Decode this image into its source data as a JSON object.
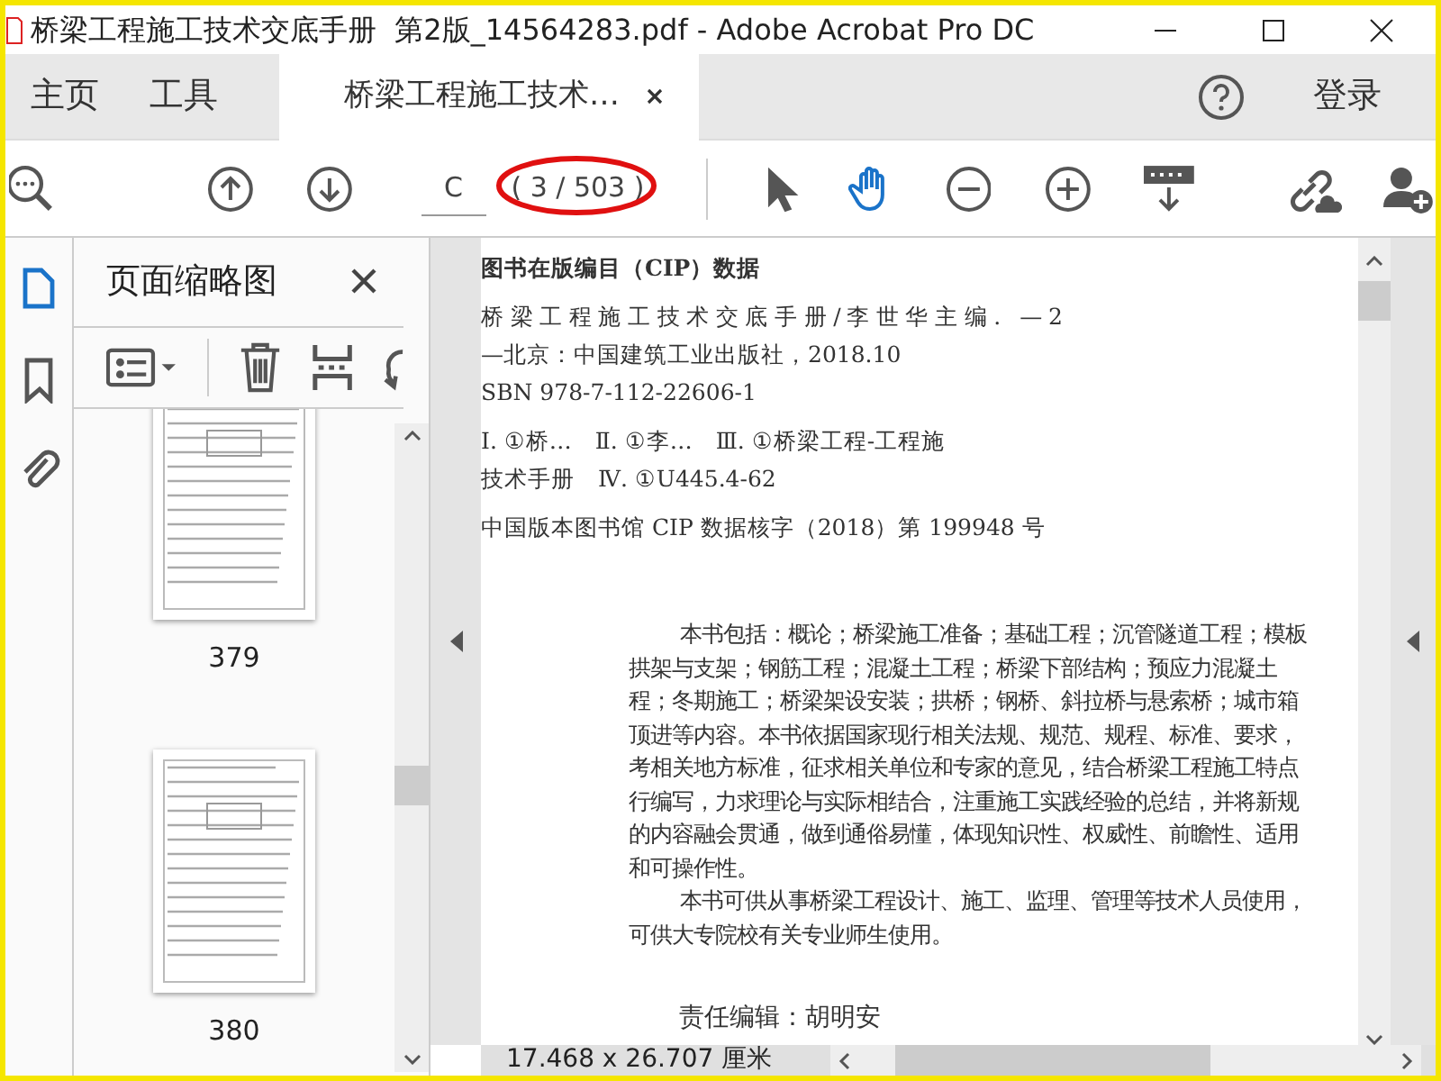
{
  "window": {
    "title": "桥梁工程施工技术交底手册  第2版_14564283.pdf - Adobe Acrobat Pro DC"
  },
  "tabs": [
    {
      "label": "主页",
      "selected": false
    },
    {
      "label": "工具",
      "selected": false
    },
    {
      "label": "桥梁工程施工技术…",
      "selected": true
    }
  ],
  "sign_in": "登录",
  "toolbar": {
    "page_field": {
      "value": "C"
    },
    "page_count": "( 3 / 503 )",
    "page_count_circled": true,
    "tools": [
      {
        "kind": "pointer",
        "selected": false
      },
      {
        "kind": "hand",
        "selected": true
      }
    ]
  },
  "sidebar": {
    "rail": [
      {
        "kind": "pages",
        "selected": true
      },
      {
        "kind": "bookmarks",
        "selected": false
      },
      {
        "kind": "attachments",
        "selected": false
      }
    ],
    "panel": {
      "title": "页面缩略图",
      "thumbnails": [
        {
          "label": "379"
        },
        {
          "label": "380"
        }
      ]
    }
  },
  "document": {
    "lines": [
      {
        "kind": "heading",
        "text": "图书在版编目（CIP）数据"
      },
      {
        "kind": "spaced",
        "text": "桥梁工程施工技术交底手册/李世华主编. —2"
      },
      {
        "kind": "line",
        "text": "—北京：中国建筑工业出版社，2018.10"
      },
      {
        "kind": "line",
        "text": "SBN 978-7-112-22606-1"
      },
      {
        "kind": "line",
        "text": "Ⅰ. ①桥…　Ⅱ. ①李…　Ⅲ. ①桥梁工程-工程施"
      },
      {
        "kind": "line",
        "text": "技术手册　Ⅳ. ①U445.4-62"
      },
      {
        "kind": "line",
        "text": "中国版本图书馆 CIP 数据核字（2018）第 199948 号"
      },
      {
        "kind": "first",
        "text": "本书包括：概论；桥梁施工准备；基础工程；沉管隧道工程；模板"
      },
      {
        "kind": "body",
        "text": "拱架与支架；钢筋工程；混凝土工程；桥梁下部结构；预应力混凝土"
      },
      {
        "kind": "body",
        "text": "程；冬期施工；桥梁架设安装；拱桥；钢桥、斜拉桥与悬索桥；城市箱"
      },
      {
        "kind": "body",
        "text": "顶进等内容。本书依据国家现行相关法规、规范、规程、标准、要求，"
      },
      {
        "kind": "body",
        "text": "考相关地方标准，征求相关单位和专家的意见，结合桥梁工程施工特点"
      },
      {
        "kind": "body",
        "text": "行编写，力求理论与实际相结合，注重施工实践经验的总结，并将新规"
      },
      {
        "kind": "body",
        "text": "的内容融会贯通，做到通俗易懂，体现知识性、权威性、前瞻性、适用"
      },
      {
        "kind": "body",
        "text": "和可操作性。"
      },
      {
        "kind": "first",
        "text": "本书可供从事桥梁工程设计、施工、监理、管理等技术人员使用，"
      },
      {
        "kind": "body",
        "text": "可供大专院校有关专业师生使用。"
      },
      {
        "kind": "credit",
        "text": "责任编辑：胡明安"
      }
    ]
  },
  "status_bar": {
    "page_size": "17.468 x 26.707 厘米"
  }
}
